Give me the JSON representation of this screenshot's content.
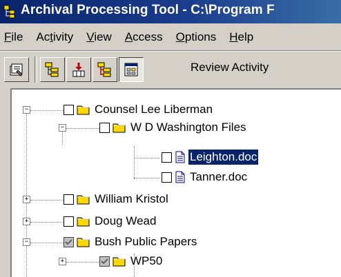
{
  "window": {
    "title": "Archival Processing Tool - C:\\Program F",
    "title_bg": "#0a246a"
  },
  "menu": {
    "items": [
      {
        "pre": "",
        "acc": "F",
        "post": "ile"
      },
      {
        "pre": "Ac",
        "acc": "t",
        "post": "ivity"
      },
      {
        "pre": "",
        "acc": "V",
        "post": "iew"
      },
      {
        "pre": "",
        "acc": "A",
        "post": "ccess"
      },
      {
        "pre": "",
        "acc": "O",
        "post": "ptions"
      },
      {
        "pre": "",
        "acc": "H",
        "post": "elp"
      }
    ]
  },
  "toolbar": {
    "label": "Review Activity",
    "buttons": [
      "properties-icon",
      "tree-folder-icon",
      "extract-icon",
      "tree-review-icon",
      "review-activity-icon"
    ]
  },
  "tree": {
    "nodes": [
      {
        "label": "Counsel Lee Liberman",
        "expander": "−",
        "checked": false,
        "icon": "folder-icon"
      },
      {
        "label": "W D Washington Files",
        "expander": "−",
        "checked": false,
        "icon": "folder-icon"
      },
      {
        "label": "Leighton.doc",
        "expander": "",
        "checked": false,
        "icon": "document-icon",
        "selected": true
      },
      {
        "label": "Tanner.doc",
        "expander": "",
        "checked": false,
        "icon": "document-icon"
      },
      {
        "label": "William Kristol",
        "expander": "+",
        "checked": false,
        "icon": "folder-icon"
      },
      {
        "label": "Doug Wead",
        "expander": "+",
        "checked": false,
        "icon": "folder-icon"
      },
      {
        "label": "Bush Public Papers",
        "expander": "−",
        "checked": true,
        "icon": "folder-icon"
      },
      {
        "label": "WP50",
        "expander": "+",
        "checked": true,
        "icon": "folder-icon"
      }
    ],
    "selection_color": "#0a246a"
  }
}
